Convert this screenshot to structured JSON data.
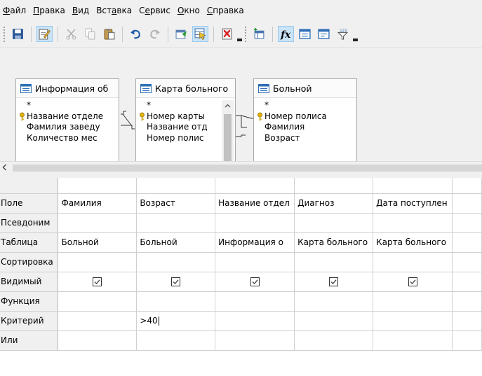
{
  "menu": [
    {
      "hot": "Ф",
      "rest": "айл"
    },
    {
      "hot": "П",
      "rest": "равка"
    },
    {
      "hot": "В",
      "rest": "ид"
    },
    {
      "pre": "Вст",
      "hot": "а",
      "rest": "вка"
    },
    {
      "pre": "С",
      "hot": "е",
      "rest": "рвис"
    },
    {
      "hot": "О",
      "rest": "кно"
    },
    {
      "hot": "С",
      "rest": "правка"
    }
  ],
  "toolbar_icons": [
    "save-icon",
    "edit-mode-icon",
    "cut-icon",
    "copy-icon",
    "paste-icon",
    "undo-icon",
    "redo-icon",
    "run-query-icon",
    "design-view-icon",
    "clear-query-icon",
    "add-table-icon",
    "functions-icon",
    "table-name-icon",
    "alias-icon",
    "distinct-values-icon"
  ],
  "tables": [
    {
      "title": "Информация об",
      "fields": [
        "*",
        "Название отделе",
        "Фамилия заведу",
        "Количество мес"
      ],
      "key_index": 1
    },
    {
      "title": "Карта больного",
      "fields": [
        "*",
        "Номер карты",
        "Название отд",
        "Номер полис"
      ],
      "key_index": 1
    },
    {
      "title": "Больной",
      "fields": [
        "*",
        "Номер полиса",
        "Фамилия",
        "Возраст"
      ],
      "key_index": 1
    }
  ],
  "grid": {
    "row_headers": {
      "field": "Поле",
      "alias": "Псевдоним",
      "table": "Таблица",
      "sort": "Сортировка",
      "visible": "Видимый",
      "function": "Функция",
      "criterion": "Критерий",
      "or": "Или"
    },
    "columns": [
      {
        "field": "Фамилия",
        "table": "Больной",
        "visible": true,
        "criterion": ""
      },
      {
        "field": "Возраст",
        "table": "Больной",
        "visible": true,
        "criterion": ">40"
      },
      {
        "field": "Название отдел",
        "table": "Информация о",
        "visible": true,
        "criterion": ""
      },
      {
        "field": "Диагноз",
        "table": "Карта больного",
        "visible": true,
        "criterion": ""
      },
      {
        "field": "Дата поступлен",
        "table": "Карта больного",
        "visible": true,
        "criterion": ""
      }
    ]
  },
  "colors": {
    "chrome": "#f0f0f0",
    "key_icon": "#c89b00",
    "active_button": "#cce4f7"
  }
}
